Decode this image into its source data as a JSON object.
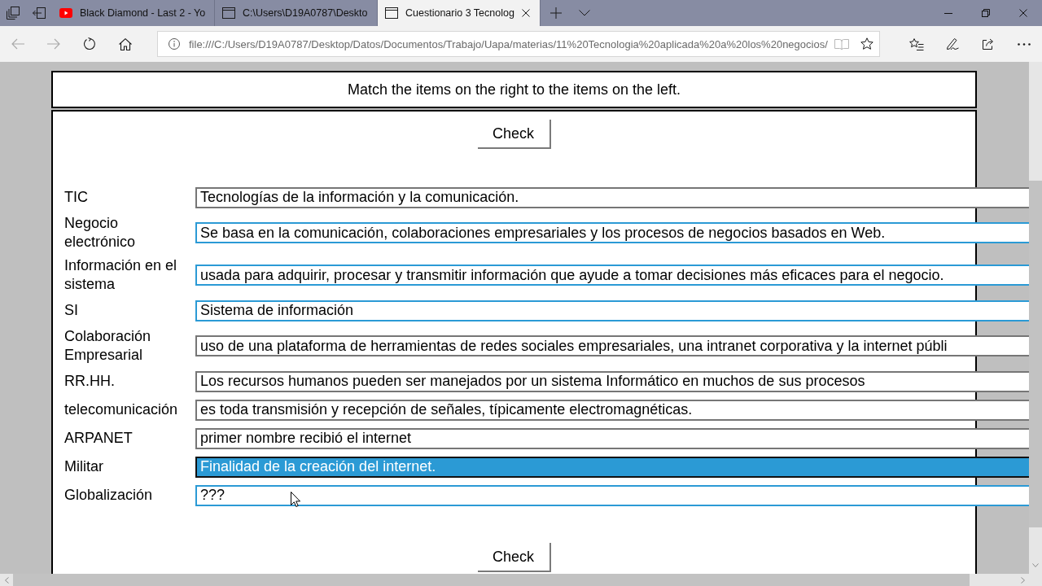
{
  "tabs": [
    {
      "title": "Black Diamond - Last 2 - Yo",
      "kind": "video",
      "selected": false
    },
    {
      "title": "C:\\Users\\D19A0787\\Deskto",
      "kind": "page",
      "selected": false
    },
    {
      "title": "Cuestionario 3 Tecnolog",
      "kind": "page",
      "selected": true
    }
  ],
  "navigation": [
    {
      "kind": "back",
      "disabled": true
    },
    {
      "kind": "forward",
      "disabled": true
    },
    {
      "kind": "refresh",
      "disabled": false
    },
    {
      "kind": "home",
      "disabled": false
    }
  ],
  "address_bar": {
    "url": "file:///C:/Users/D19A0787/Desktop/Datos/Documentos/Trabajo/Uapa/materias/11%20Tecnologia%20aplicada%20a%20los%20negocios/",
    "reading_view": {
      "disabled": true
    }
  },
  "quiz": {
    "instructions": "Match the items on the right to the items on the left.",
    "check_button_top": "Check",
    "items": [
      {
        "term": "TIC",
        "answer": "Tecnologías de la información y la comunicación.",
        "highlighted": false,
        "selected": false
      },
      {
        "term": "Negocio electrónico",
        "answer": "Se basa en la comunicación, colaboraciones empresariales y los procesos de negocios basados en Web.",
        "highlighted": true,
        "selected": false
      },
      {
        "term": "Información en el sistema",
        "answer": "usada para adquirir, procesar y transmitir información que ayude a tomar decisiones más eficaces para el negocio.",
        "highlighted": true,
        "selected": false
      },
      {
        "term": "SI",
        "answer": "Sistema de información",
        "highlighted": true,
        "selected": false
      },
      {
        "term": "Colaboración Empresarial",
        "answer": "uso de una plataforma de herramientas de redes sociales empresariales, una intranet corporativa y la internet públi",
        "highlighted": false,
        "selected": false
      },
      {
        "term": "RR.HH.",
        "answer": "Los recursos humanos pueden ser manejados por un sistema Informático en muchos de sus procesos",
        "highlighted": false,
        "selected": false
      },
      {
        "term": "telecomunicación",
        "answer": "es toda transmisión y recepción de señales, típicamente electromagnéticas.",
        "highlighted": false,
        "selected": false
      },
      {
        "term": "ARPANET",
        "answer": "primer nombre recibió el internet",
        "highlighted": false,
        "selected": false
      },
      {
        "term": "Militar",
        "answer": "Finalidad de la creación del internet.",
        "highlighted": false,
        "selected": true
      },
      {
        "term": "Globalización",
        "answer": "???",
        "highlighted": true,
        "selected": false
      }
    ],
    "check_button_bottom": "Check"
  }
}
